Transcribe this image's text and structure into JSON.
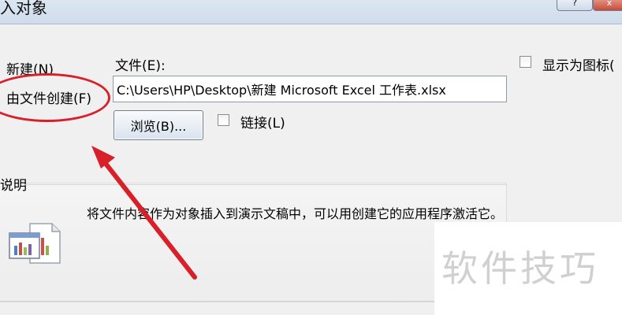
{
  "dialog": {
    "title": "入对象",
    "help_label": "?",
    "close_label": "x"
  },
  "mode_options": {
    "new_label": "新建(N)",
    "from_file_label": "由文件创建(F)"
  },
  "file": {
    "caption": "文件(E):",
    "path_value": "C:\\Users\\HP\\Desktop\\新建 Microsoft Excel 工作表.xlsx",
    "browse_label": "浏览(B)...",
    "link_label": "链接(L)",
    "link_checked": false
  },
  "display_as_icon": {
    "label": "显示为图标(",
    "checked": false
  },
  "description": {
    "caption": "说明",
    "text": "将文件内容作为对象插入到演示文稿中，可以用创建它的应用程序激活它。"
  },
  "watermark": {
    "text": "软件技巧"
  },
  "colors": {
    "annotation_red": "#d8202a"
  },
  "icons": [
    "document-chart-icon",
    "arrow-annotation",
    "ellipse-annotation"
  ]
}
